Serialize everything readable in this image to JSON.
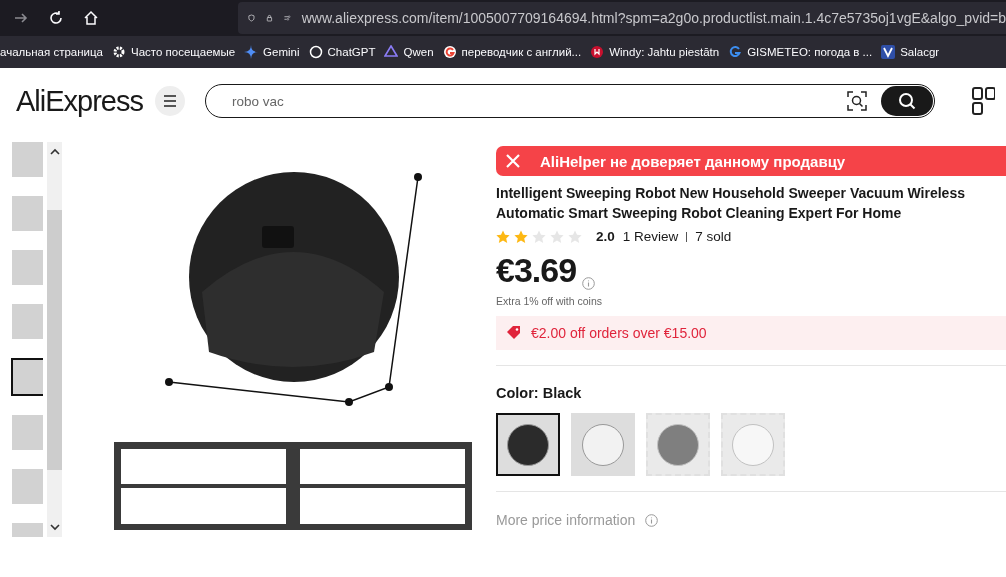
{
  "browser": {
    "url": "www.aliexpress.com/item/1005007709164694.html?spm=a2g0o.productlist.main.1.4c7e5735oj1vgE&algo_pvid=b",
    "bookmarks": [
      {
        "label": "ачальная страница"
      },
      {
        "label": "Часто посещаемые"
      },
      {
        "label": "Gemini"
      },
      {
        "label": "ChatGPT"
      },
      {
        "label": "Qwen"
      },
      {
        "label": "переводчик с англий..."
      },
      {
        "label": "Windy: Jahtu piestātn"
      },
      {
        "label": "GISMETEO: погода в ..."
      },
      {
        "label": "Salacgr"
      }
    ]
  },
  "header": {
    "logo": "AliExpress",
    "search": {
      "value": "robo vac"
    }
  },
  "gallery": {
    "thumbnails": [
      {
        "selected": false
      },
      {
        "selected": false
      },
      {
        "selected": false
      },
      {
        "selected": false
      },
      {
        "selected": true
      },
      {
        "selected": false
      },
      {
        "selected": false
      },
      {
        "selected": false
      }
    ]
  },
  "product": {
    "warning": "AliHelper не доверяет данному продавцу",
    "title": "Intelligent Sweeping Robot New Household Sweeper Vacuum Wireless Automatic Smart Sweeping Robot Cleaning Expert For Home",
    "stars": 2,
    "rating": "2.0",
    "reviews": "1 Review",
    "sold": "7 sold",
    "price": "€3.69",
    "coins": "Extra 1% off with coins",
    "coupon": "€2.00 off orders over €15.00",
    "color_label": "Color: Black",
    "colors": [
      {
        "selected": true,
        "available": true
      },
      {
        "selected": false,
        "available": true
      },
      {
        "selected": false,
        "available": false
      },
      {
        "selected": false,
        "available": false
      }
    ],
    "more": "More price information"
  }
}
